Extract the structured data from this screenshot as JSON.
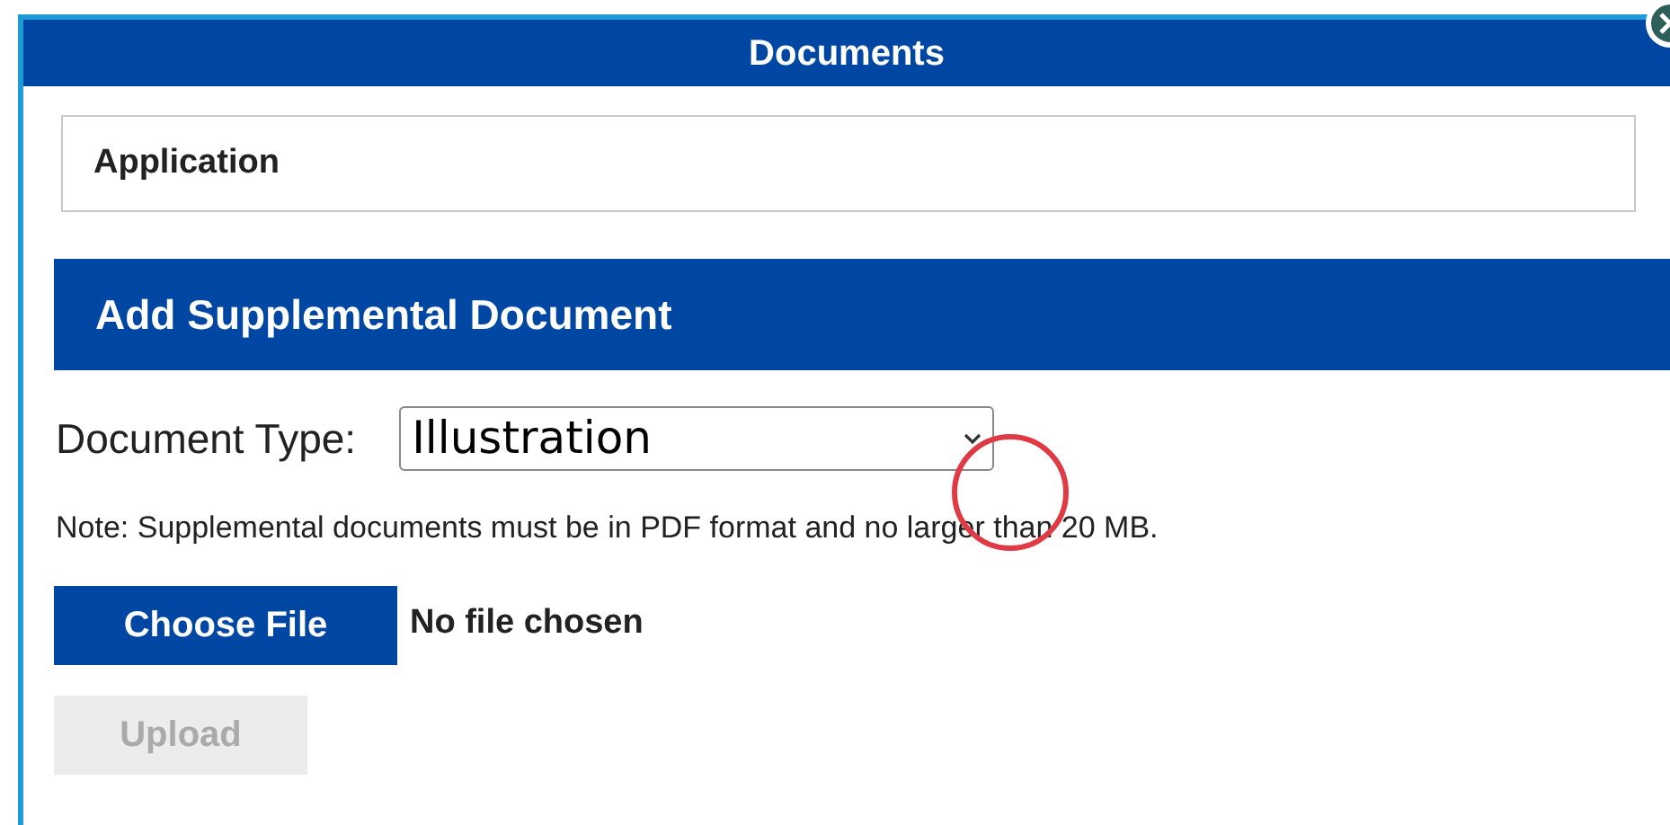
{
  "dialog": {
    "title": "Documents"
  },
  "application": {
    "label": "Application"
  },
  "section": {
    "title": "Add Supplemental Document"
  },
  "document_type": {
    "label": "Document Type:",
    "value": "Illustration"
  },
  "note": "Note: Supplemental documents must be in PDF format and no larger than 20 MB.",
  "file": {
    "button": "Choose File",
    "status": "No file chosen"
  },
  "upload": {
    "label": "Upload",
    "disabled": true
  }
}
